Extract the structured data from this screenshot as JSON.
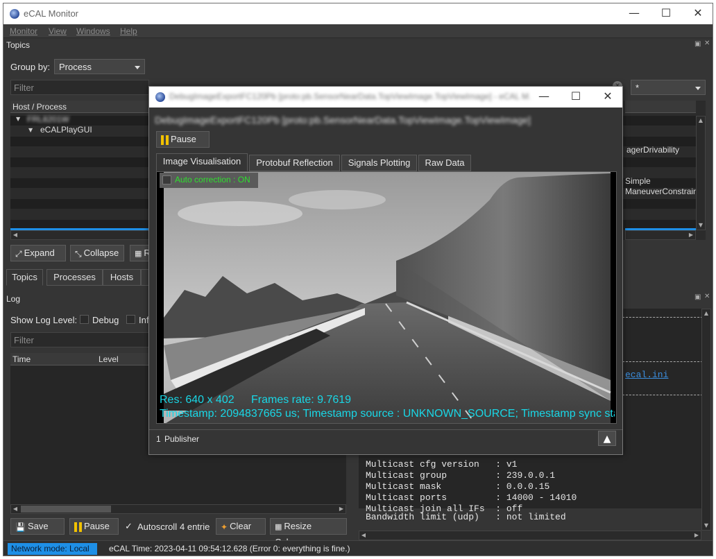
{
  "app": {
    "title": "eCAL Monitor",
    "menu": [
      "Monitor",
      "View",
      "Windows",
      "Help"
    ]
  },
  "topics_panel": {
    "title": "Topics",
    "group_by_label": "Group by:",
    "group_by_value": "Process",
    "filter_placeholder": "Filter",
    "filter_combo_value": "*",
    "column_header": "Host / Process",
    "tree": {
      "host": "FRL8201W",
      "process": "eCALPlayGUI"
    },
    "right_fragments": [
      "agerDrivability",
      "Simple",
      "ManeuverConstrain"
    ],
    "buttons": {
      "expand": "Expand",
      "collapse": "Collapse",
      "reset_partial": "R"
    },
    "tabs": [
      "Topics",
      "Processes",
      "Hosts"
    ]
  },
  "log_panel": {
    "title": "Log",
    "show_log_level_label": "Show Log Level:",
    "debug_label": "Debug",
    "info_partial": "Inf",
    "filter_placeholder": "Filter",
    "columns": [
      "Time",
      "Level"
    ],
    "buttons": {
      "save_as": "Save as...",
      "pause": "Pause",
      "autoscroll": "Autoscroll",
      "entries": "4 entrie",
      "clear": "Clear",
      "resize_columns": "Resize Columns"
    }
  },
  "config_panel": {
    "link_text": "ecal.ini",
    "rows": [
      {
        "key": "Multicast cfg version   ",
        "value": "v1"
      },
      {
        "key": "Multicast group         ",
        "value": "239.0.0.1"
      },
      {
        "key": "Multicast mask          ",
        "value": "0.0.0.15"
      },
      {
        "key": "Multicast ports         ",
        "value": "14000 - 14010"
      },
      {
        "key": "Multicast join all IFs  ",
        "value": "off"
      },
      {
        "key": "Bandwidth limit (udp)   ",
        "value": "not limited"
      }
    ]
  },
  "status_bar": {
    "network_mode": "Network mode: Local",
    "ecal_time": "eCAL Time: 2023-04-11 09:54:12.628 (Error 0: everything is fine.)"
  },
  "popup": {
    "title": "DebugImageExportFC120Pb [proto:pb.SensorNearData.TopViewImage.TopViewImage] - eCAL M...",
    "topic_line": "DebugImageExportFC120Pb [proto:pb.SensorNearData.TopViewImage.TopViewImage]",
    "pause_label": "Pause",
    "tabs": [
      "Image Visualisation",
      "Protobuf Reflection",
      "Signals Plotting",
      "Raw Data"
    ],
    "active_tab": 0,
    "auto_correction": "Auto correction : ON",
    "res_text": "Res: 640 x 402",
    "frame_rate_text": "Frames rate: 9.7619",
    "timestamp_text": "Timestamp: 2094837665 us; Timestamp source : UNKNOWN_SOURCE; Timestamp sync sta",
    "publisher_count": "1",
    "publisher_label": "Publisher"
  },
  "colors": {
    "background": "#353535",
    "accent_blue": "#1e8fe6",
    "overlay_cyan": "#19d7e6",
    "auto_correction_green": "#2ee02e"
  }
}
